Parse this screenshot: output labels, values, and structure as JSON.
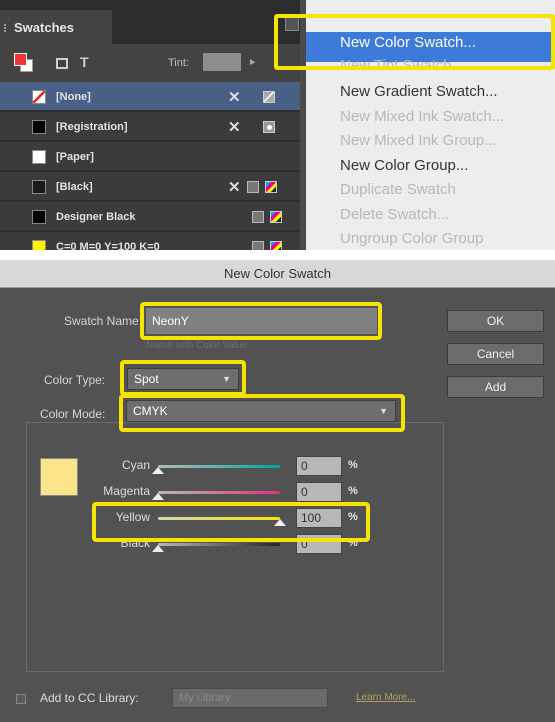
{
  "swatches_panel": {
    "tab_label": "Swatches",
    "toolbar_t": "T",
    "tint_label": "Tint:",
    "tint_value": "",
    "rows": [
      {
        "name": "[None]",
        "chip": "none",
        "selected": true
      },
      {
        "name": "[Registration]",
        "chip": "#000000"
      },
      {
        "name": "[Paper]",
        "chip": "#ffffff"
      },
      {
        "name": "[Black]",
        "chip": "#1a1a1a"
      },
      {
        "name": "Designer Black",
        "chip": "#000000"
      },
      {
        "name": "C=0 M=0 Y=100 K=0",
        "chip": "#fff200"
      }
    ]
  },
  "flyout_menu": {
    "items": [
      {
        "label": "New Color Swatch...",
        "state": "highlighted"
      },
      {
        "label": "New Tint Swatch...",
        "state": "disabled"
      },
      {
        "label": "New Gradient Swatch...",
        "state": "enabled"
      },
      {
        "label": "New Mixed Ink Swatch...",
        "state": "disabled"
      },
      {
        "label": "New Mixed Ink Group...",
        "state": "disabled"
      },
      {
        "label": "New Color Group...",
        "state": "enabled"
      },
      {
        "label": "Duplicate Swatch",
        "state": "disabled"
      },
      {
        "label": "Delete Swatch...",
        "state": "disabled"
      },
      {
        "label": "Ungroup Color Group",
        "state": "disabled"
      }
    ]
  },
  "dialog": {
    "title": "New Color Swatch",
    "swatch_name_label": "Swatch Name:",
    "swatch_name_value": "NeonY",
    "name_hint": "Name with Color Value",
    "color_type_label": "Color Type:",
    "color_type_value": "Spot",
    "color_mode_label": "Color Mode:",
    "color_mode_value": "CMYK",
    "ok_label": "OK",
    "cancel_label": "Cancel",
    "add_label": "Add",
    "sliders": [
      {
        "label": "Cyan",
        "value": "0",
        "unit": "%",
        "level": 0,
        "track": "linear-gradient(90deg,#b9b9b9,#00a6a0)"
      },
      {
        "label": "Magenta",
        "value": "0",
        "unit": "%",
        "level": 0,
        "track": "linear-gradient(90deg,#b9b9b9,#e0307a)"
      },
      {
        "label": "Yellow",
        "value": "100",
        "unit": "%",
        "level": 1,
        "track": "linear-gradient(90deg,#d6d6b0,#f3e600)"
      },
      {
        "label": "Black",
        "value": "0",
        "unit": "%",
        "level": 0,
        "track": "linear-gradient(90deg,#b9b9b9,#222222)"
      }
    ],
    "preview_color": "#fbe58a",
    "cc_label": "Add to CC Library:",
    "cc_library_value": "My Library",
    "learn_more": "Learn More..."
  },
  "colors": {
    "highlight": "#f5e300",
    "menu_selection": "#3d7ad9",
    "panel_selection": "#4a5f86"
  }
}
